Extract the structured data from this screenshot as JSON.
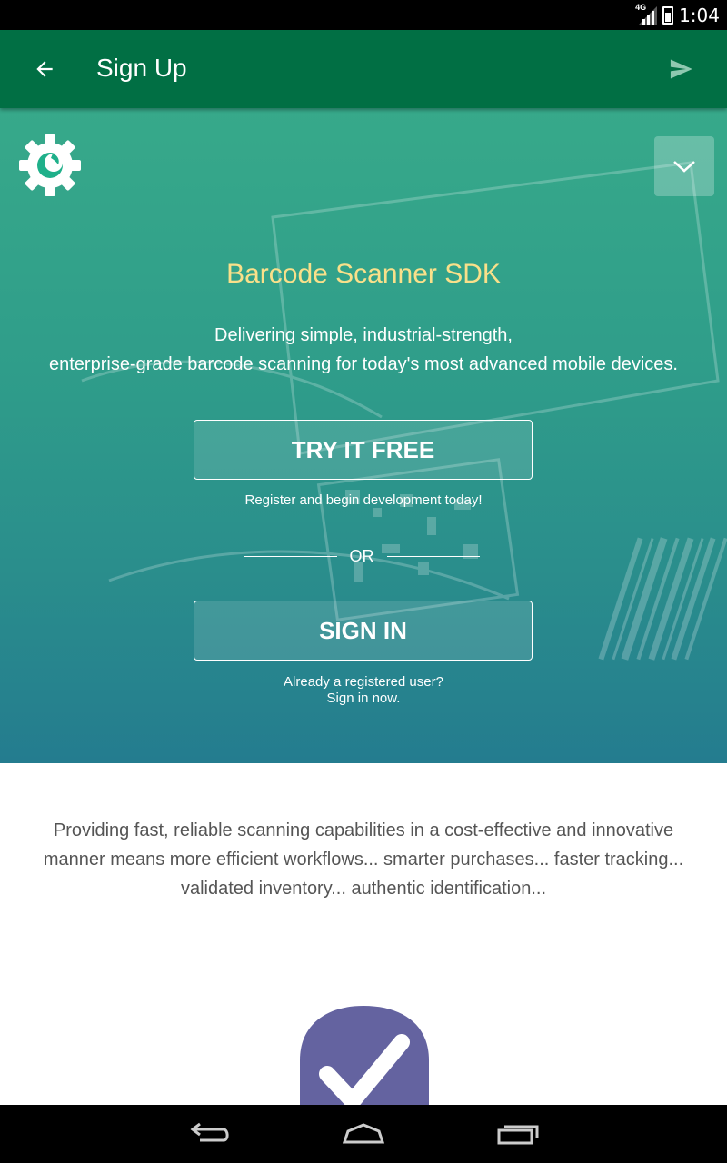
{
  "status_bar": {
    "network": "4G",
    "time": "1:04"
  },
  "app_bar": {
    "title": "Sign Up",
    "icons": [
      "back-arrow-icon",
      "send-icon"
    ]
  },
  "hero": {
    "title": "Barcode Scanner SDK",
    "description_lines": [
      "Delivering simple, industrial-strength,",
      "enterprise-grade barcode scanning for today's most advanced mobile devices."
    ],
    "try_button_label": "TRY IT FREE",
    "try_caption": "Register and begin development today!",
    "or_label": "OR",
    "signin_button_label": "SIGN IN",
    "signin_caption_lines": [
      "Already a registered user?",
      "Sign in now."
    ]
  },
  "intro_text": "Providing fast, reliable scanning capabilities in a cost-effective and innovative manner means more efficient workflows... smarter purchases... faster tracking... validated inventory... authentic identification...",
  "colors": {
    "app_bar": "#016f44",
    "hero_title": "#f9e08a",
    "hero_top": "#37a98a",
    "hero_bottom": "#247c8f",
    "badge": "#6463a0"
  },
  "nav_bar": {
    "icons": [
      "nav-back-icon",
      "nav-home-icon",
      "nav-recents-icon"
    ]
  }
}
